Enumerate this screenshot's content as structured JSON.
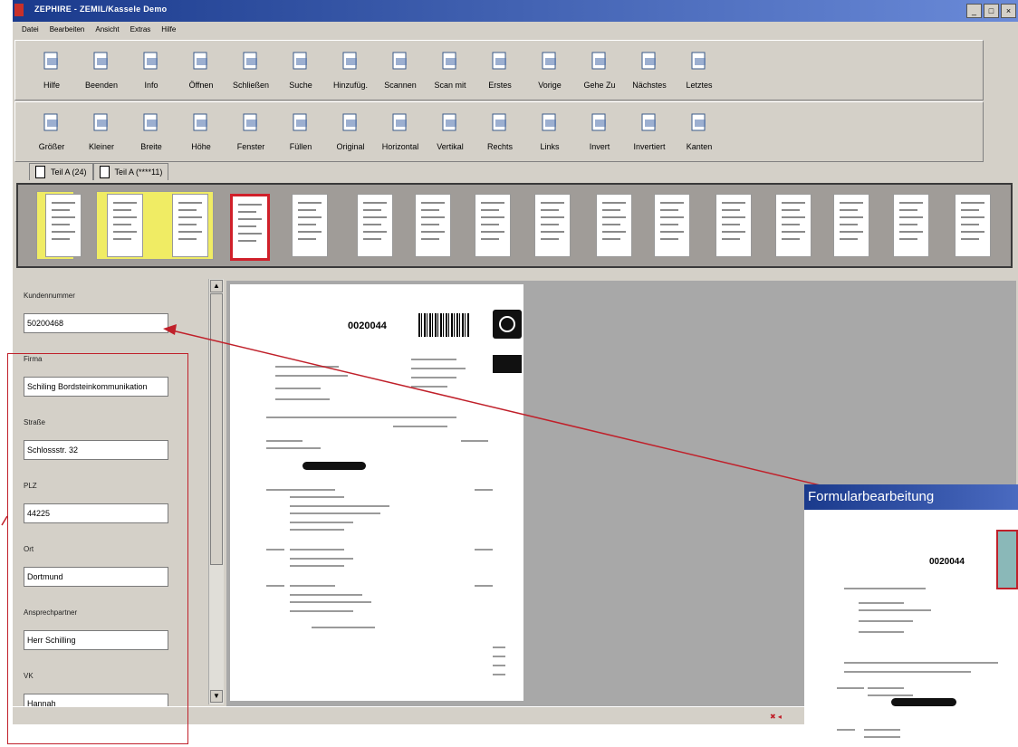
{
  "window": {
    "title": "ZEPHIRE - ZEMIL/Kassele Demo",
    "buttons": [
      "_",
      "□",
      "×"
    ]
  },
  "menu": [
    "Datei",
    "Bearbeiten",
    "Ansicht",
    "Extras",
    "Hilfe"
  ],
  "toolbar1": [
    {
      "label": "Hilfe",
      "icon": "help-icon"
    },
    {
      "label": "Beenden",
      "icon": "exit-icon"
    },
    {
      "label": "Info",
      "icon": "info-icon"
    },
    {
      "label": "Öffnen",
      "icon": "open-icon"
    },
    {
      "label": "Schließen",
      "icon": "close-doc-icon"
    },
    {
      "label": "Suche",
      "icon": "search-folder-icon"
    },
    {
      "label": "Hinzufüg.",
      "icon": "add-icon"
    },
    {
      "label": "Scannen",
      "icon": "scan-icon"
    },
    {
      "label": "Scan mit",
      "icon": "scan-with-icon"
    },
    {
      "label": "Erstes",
      "icon": "first-icon"
    },
    {
      "label": "Vorige",
      "icon": "previous-icon"
    },
    {
      "label": "Gehe Zu",
      "icon": "goto-icon"
    },
    {
      "label": "Nächstes",
      "icon": "next-icon"
    },
    {
      "label": "Letztes",
      "icon": "last-icon"
    }
  ],
  "toolbar2": [
    {
      "label": "Größer",
      "icon": "zoom-in-icon"
    },
    {
      "label": "Kleiner",
      "icon": "zoom-out-icon"
    },
    {
      "label": "Breite",
      "icon": "fit-width-icon"
    },
    {
      "label": "Höhe",
      "icon": "fit-height-icon"
    },
    {
      "label": "Fenster",
      "icon": "fit-window-icon"
    },
    {
      "label": "Füllen",
      "icon": "fill-icon"
    },
    {
      "label": "Original",
      "icon": "original-icon"
    },
    {
      "label": "Horizontal",
      "icon": "horizontal-icon"
    },
    {
      "label": "Vertikal",
      "icon": "vertical-icon"
    },
    {
      "label": "Rechts",
      "icon": "rotate-right-icon"
    },
    {
      "label": "Links",
      "icon": "rotate-left-icon"
    },
    {
      "label": "Invert",
      "icon": "invert-icon"
    },
    {
      "label": "Invertiert",
      "icon": "inverted-icon"
    },
    {
      "label": "Kanten",
      "icon": "edges-icon"
    }
  ],
  "tabs": [
    {
      "label": "Teil A (24)"
    },
    {
      "label": "Teil A (****11)"
    }
  ],
  "thumbnail_count": 16,
  "form": {
    "fields": [
      {
        "label": "Kundennummer",
        "value": "50200468"
      },
      {
        "label": "Firma",
        "value": "Schiling Bordsteinkommunikation"
      },
      {
        "label": "Straße",
        "value": "Schlossstr. 32"
      },
      {
        "label": "PLZ",
        "value": "44225"
      },
      {
        "label": "Ort",
        "value": "Dortmund"
      },
      {
        "label": "Ansprechpartner",
        "value": "Herr Schilling"
      },
      {
        "label": "VK",
        "value": "Hannah"
      }
    ]
  },
  "document": {
    "number": "0020044"
  },
  "inset": {
    "title": "Formularbearbeitung",
    "number": "0020044"
  },
  "colors": {
    "title_bar": "#1a3a8c",
    "highlight_yellow": "#f0ec64",
    "selection_red": "#d0202a"
  }
}
